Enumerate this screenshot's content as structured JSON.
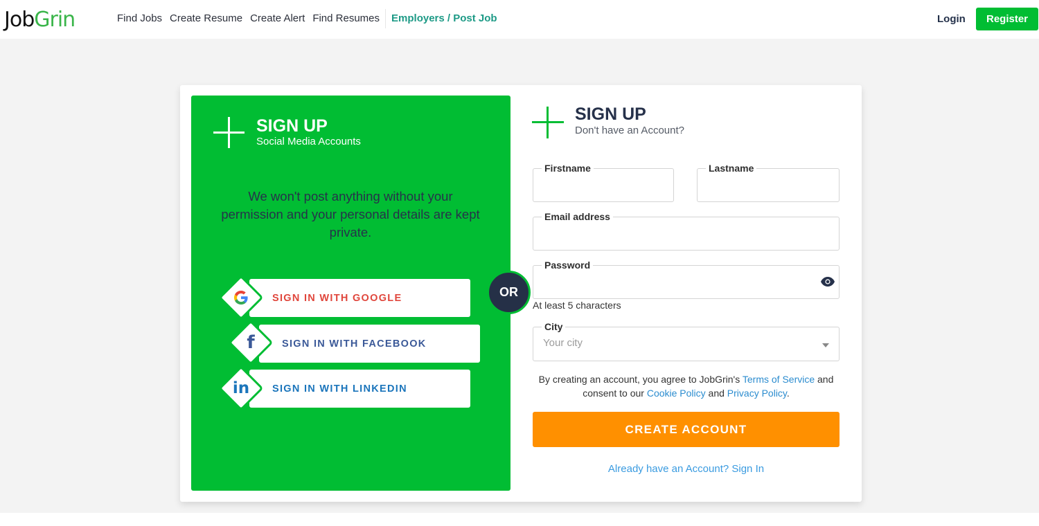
{
  "header": {
    "logo": {
      "part1": "Job",
      "part2": "Grin"
    },
    "nav": [
      {
        "label": "Find Jobs"
      },
      {
        "label": "Create Resume"
      },
      {
        "label": "Create Alert"
      },
      {
        "label": "Find Resumes"
      }
    ],
    "employers_link": "Employers / Post Job",
    "login": "Login",
    "register": "Register"
  },
  "social_panel": {
    "title": "SIGN UP",
    "subtitle": "Social Media Accounts",
    "message": "We won't post anything without your permission and your personal details are kept private.",
    "buttons": [
      {
        "label": "SIGN IN WITH GOOGLE",
        "icon": "google-icon",
        "color": "#e0463c"
      },
      {
        "label": "SIGN IN WITH FACEBOOK",
        "icon": "facebook-icon",
        "color": "#3b5998"
      },
      {
        "label": "SIGN IN WITH LINKEDIN",
        "icon": "linkedin-icon",
        "color": "#1b75bb"
      }
    ],
    "or_label": "OR"
  },
  "form": {
    "title": "SIGN UP",
    "subtitle": "Don't have an Account?",
    "fields": {
      "firstname": {
        "label": "Firstname",
        "value": ""
      },
      "lastname": {
        "label": "Lastname",
        "value": ""
      },
      "email": {
        "label": "Email address",
        "value": ""
      },
      "password": {
        "label": "Password",
        "value": "",
        "hint": "At least 5 characters"
      },
      "city": {
        "label": "City",
        "placeholder": "Your city"
      }
    },
    "terms": {
      "prefix": "By creating an account, you agree to JobGrin's ",
      "tos": "Terms of Service",
      "mid": " and consent to our ",
      "cookie": "Cookie Policy",
      "and": " and ",
      "privacy": "Privacy Policy",
      "suffix": "."
    },
    "create_button": "CREATE ACCOUNT",
    "signin_link": "Already have an Account? Sign In"
  },
  "colors": {
    "brand_green": "#01bd33",
    "accent_orange": "#ff9000",
    "dark_navy": "#253047",
    "link_blue": "#2b8ccf"
  }
}
